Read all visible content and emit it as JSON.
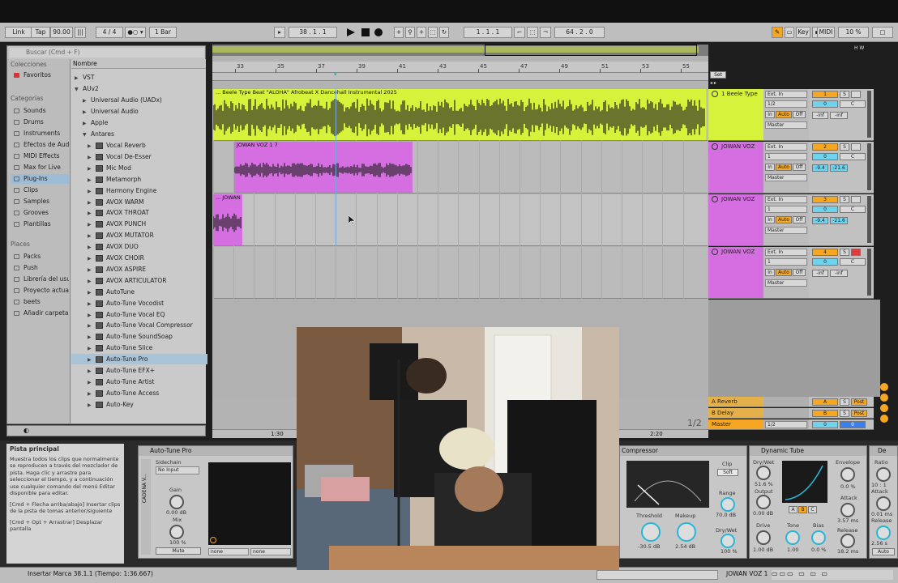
{
  "app": {
    "accent": "#f5a623",
    "lime": "#d7f23a",
    "magenta": "#d56ee0"
  },
  "control_bar": {
    "link": "Link",
    "tap": "Tap",
    "tempo": "90.00",
    "meter": "4 / 4",
    "metronome_icon": "circle-icon",
    "quantize": "1 Bar",
    "position": "38 .  1 .  1",
    "loop_start": "1 .  1 .  1",
    "loop_length": "64 .  2 .  0",
    "key": "Key",
    "midi": "MIDI",
    "cpu": "10 %"
  },
  "browser": {
    "search_placeholder": "Buscar (Cmd + F)",
    "collections_header": "Colecciones",
    "favorites": "Favoritos",
    "categories_header": "Categorías",
    "categories": [
      "Sounds",
      "Drums",
      "Instruments",
      "Efectos de Aud",
      "MIDI Effects",
      "Max for Live",
      "Plug-Ins",
      "Clips",
      "Samples",
      "Grooves",
      "Plantillas"
    ],
    "places_header": "Places",
    "places": [
      "Packs",
      "Push",
      "Librería del usu",
      "Proyecto actua",
      "beets",
      "Añadir carpeta..."
    ],
    "name_header": "Nombre",
    "tree": [
      {
        "label": "VST",
        "level": 0,
        "open": false
      },
      {
        "label": "AUv2",
        "level": 0,
        "open": true
      },
      {
        "label": "Universal Audio (UADx)",
        "level": 1,
        "open": false
      },
      {
        "label": "Universal Audio",
        "level": 1,
        "open": false
      },
      {
        "label": "Apple",
        "level": 1,
        "open": false
      },
      {
        "label": "Antares",
        "level": 1,
        "open": true
      }
    ],
    "plugins": [
      "Vocal Reverb",
      "Vocal De-Esser",
      "Mic Mod",
      "Metamorph",
      "Harmony Engine",
      "AVOX WARM",
      "AVOX THROAT",
      "AVOX PUNCH",
      "AVOX MUTATOR",
      "AVOX DUO",
      "AVOX CHOIR",
      "AVOX ASPIRE",
      "AVOX ARTICULATOR",
      "AutoTune",
      "Auto-Tune Vocodist",
      "Auto-Tune Vocal EQ",
      "Auto-Tune Vocal Compressor",
      "Auto-Tune SoundSoap",
      "Auto-Tune Slice",
      "Auto-Tune Pro",
      "Auto-Tune EFX+",
      "Auto-Tune Artist",
      "Auto-Tune Access",
      "Auto-Key"
    ],
    "selected_plugin": "Auto-Tune Pro"
  },
  "ruler": {
    "bars": [
      "33",
      "35",
      "37",
      "39",
      "41",
      "43",
      "45",
      "47",
      "49",
      "51",
      "53",
      "55"
    ],
    "time_marks": [
      "1:30",
      "2:20"
    ],
    "page": "1/2",
    "set": "Set"
  },
  "tracks": [
    {
      "clip": "... Beele Type Beat \"ALOHA\" Afrobeat X Dancehall Instrumental 2025",
      "name": "1 Beele Type",
      "input": "Ext. In",
      "channel": "1/2",
      "output": "Master",
      "num": "1",
      "vol": "-inf",
      "pan": "-inf",
      "color": "#d7f23a"
    },
    {
      "clip": "JOWAN VOZ 1 7",
      "name": "JOWAN VOZ",
      "input": "Ext. In",
      "channel": "1",
      "output": "Master",
      "num": "2",
      "vol": "-9.4",
      "pan": "-21.6",
      "color": "#d56ee0"
    },
    {
      "clip": "... JOWAN",
      "name": "JOWAN VOZ",
      "input": "Ext. In",
      "channel": "1",
      "output": "Master",
      "num": "3",
      "vol": "-9.4",
      "pan": "-21.6",
      "color": "#d56ee0"
    },
    {
      "clip": "",
      "name": "JOWAN VOZ",
      "input": "Ext. In",
      "channel": "1",
      "output": "Master",
      "num": "4",
      "vol": "-inf",
      "pan": "-inf",
      "color": "#d56ee0"
    }
  ],
  "returns": [
    {
      "name": "A Reverb",
      "letter": "A",
      "post": "Post"
    },
    {
      "name": "B Delay",
      "letter": "B",
      "post": "Post"
    },
    {
      "name": "Master",
      "letter": "",
      "channel": "1/2",
      "num": "0",
      "bus": "0"
    }
  ],
  "mixer_labels": {
    "in": "In",
    "auto": "Auto",
    "off": "Off",
    "s": "S",
    "c": "C",
    "zero": "0"
  },
  "info": {
    "title": "Pista principal",
    "body": "Muestra todos los clips que normalmente se reproducen a través del mezclador de pista. Haga clic y arrastre para seleccionar el tiempo, y a continuación use cualquier comando del menú Editar disponible para editar.",
    "tip1": "[Cmd + Flecha arriba/abajo] Insertar clips de la pista de tomas anterior/siguiente",
    "tip2": "[Cmd + Opt + Arrastrar] Desplazar pantalla"
  },
  "autotune_device": {
    "title": "Auto-Tune Pro",
    "chain": "CADENA V...",
    "sidechain": "Sidechain",
    "sidechain_val": "No Input",
    "gain": "Gain",
    "gain_val": "0.00 dB",
    "mix": "Mix",
    "mix_val": "100 %",
    "mute": "Mute",
    "none1": "none",
    "none2": "none"
  },
  "compressor": {
    "title": "Compressor",
    "scale": [
      "-5",
      "5",
      "10",
      "15",
      "20"
    ],
    "clip": "Clip",
    "soft": "Soft",
    "range": "Range",
    "range_val": "70.0 dB",
    "drywet": "Dry/Wet",
    "drywet_val": "100 %",
    "threshold": "Threshold",
    "threshold_val": "-30.5 dB",
    "makeup": "Makeup",
    "makeup_val": "2.54 dB",
    "ext": "sidechain"
  },
  "dynamic_tube": {
    "title": "Dynamic Tube",
    "drywet": "Dry/Wet",
    "drywet_val": "51.6 %",
    "output": "Output",
    "output_val": "0.00 dB",
    "drive": "Drive",
    "drive_val": "1.00 dB",
    "tone": "Tone",
    "tone_val": "1.00",
    "bias": "Bias",
    "bias_val": "0.0 %",
    "envelope": "Envelope",
    "envelope_val": "0.0 %",
    "attack": "Attack",
    "attack_val": "3.57 ms",
    "release": "Release",
    "release_val": "18.2 ms",
    "abc": [
      "A",
      "B",
      "C"
    ]
  },
  "next_device": {
    "title": "De",
    "ratio": "Ratio",
    "ratio_val": "10 : 1",
    "attack": "Attack",
    "attack_val": "0.01 ms",
    "release": "Release",
    "release_val": "2.56 s",
    "auto": "Auto"
  },
  "status": {
    "text": "Insertar Marca 38.1.1 (Tiempo: 1:36.667)",
    "track": "JOWAN VOZ 1"
  }
}
